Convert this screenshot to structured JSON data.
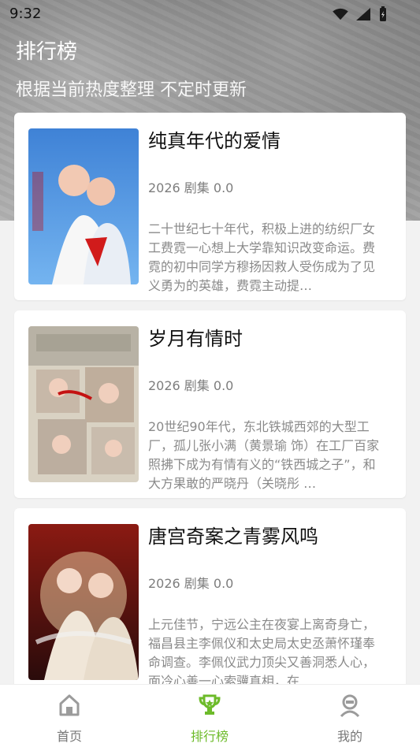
{
  "status_bar": {
    "time": "9:32",
    "icons": [
      "wifi-icon",
      "signal-icon",
      "battery-icon"
    ]
  },
  "header": {
    "title": "排行榜",
    "subtitle": "根据当前热度整理 不定时更新"
  },
  "items": [
    {
      "title": "纯真年代的爱情",
      "meta": "2026 剧集 0.0",
      "description": "二十世纪七十年代，积极上进的纺织厂女工费霓一心想上大学靠知识改变命运。费霓的初中同学方穆扬因救人受伤成为了见义勇为的英雄，费霓主动提…"
    },
    {
      "title": "岁月有情时",
      "meta": "2026 剧集 0.0",
      "description": "20世纪90年代，东北铁城西郊的大型工厂，孤儿张小满（黄景瑜 饰）在工厂百家照拂下成为有情有义的“铁西城之子”，和大方果敢的严晓丹（关晓彤 …"
    },
    {
      "title": "唐宫奇案之青雾风鸣",
      "meta": "2026 剧集 0.0",
      "description": "上元佳节，宁远公主在夜宴上离奇身亡，福昌县主李佩仪和太史局太史丞萧怀瑾奉命调查。李佩仪武力顶尖又善洞悉人心，面冷心善一心索骥真相，在…"
    }
  ],
  "tabbar": {
    "tabs": [
      {
        "label": "首页",
        "icon": "home-icon"
      },
      {
        "label": "排行榜",
        "icon": "trophy-icon"
      },
      {
        "label": "我的",
        "icon": "profile-icon"
      }
    ],
    "active": "排行榜",
    "active_color": "#6dbb2a"
  }
}
